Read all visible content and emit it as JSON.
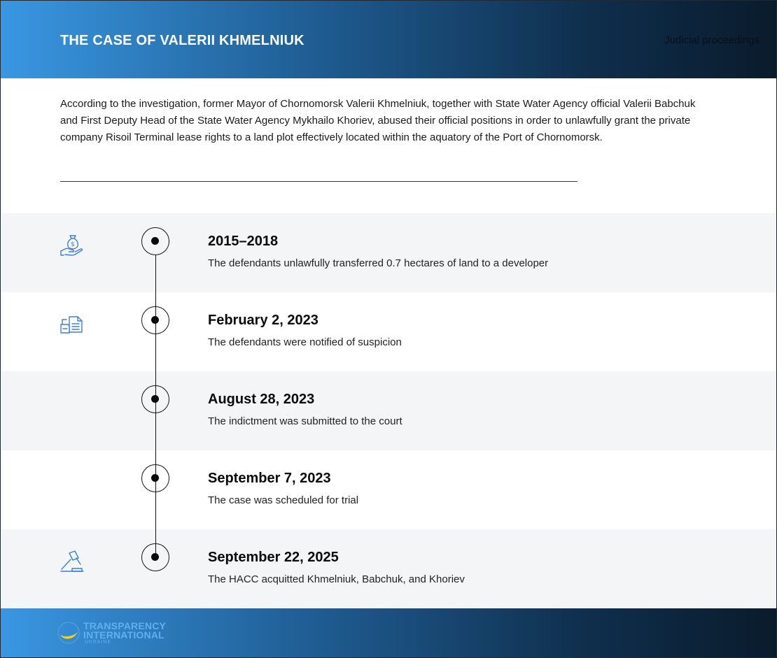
{
  "header": {
    "title": "THE CASE OF VALERII KHMELNIUK",
    "category": "Judicial proceedings"
  },
  "intro": "According to the investigation, former Mayor of Chornomorsk Valerii Khmelniuk, together with State Water Agency official Valerii Babchuk and First Deputy Head of the State Water Agency Mykhailo Khoriev, abused their official positions in order to unlawfully grant the private company Risoil Terminal lease rights to a land plot effectively located within the aquatory of the Port of Chornomorsk.",
  "timeline": [
    {
      "date": "2015–2018",
      "description": "The defendants unlawfully transferred 0.7 hectares of land to a developer",
      "icon": "money-bag-hand-icon"
    },
    {
      "date": "February 2, 2023",
      "description": "The defendants were notified of suspicion",
      "icon": "documents-icon"
    },
    {
      "date": "August 28, 2023",
      "description": "The indictment was submitted to the court",
      "icon": ""
    },
    {
      "date": "September 7, 2023",
      "description": "The case was scheduled for trial",
      "icon": ""
    },
    {
      "date": "September 22, 2025",
      "description": "The HACC acquitted Khmelniuk, Babchuk, and Khoriev",
      "icon": "gavel-icon"
    }
  ],
  "footer": {
    "logo_line1": "TRANSPARENCY",
    "logo_line2": "INTERNATIONAL",
    "logo_line3": "UKRAINE"
  },
  "colors": {
    "accent_blue": "#3a97e2",
    "dark_navy": "#0a1b2c",
    "icon_blue": "#3b7fd6",
    "row_shade": "#f4f5f7"
  }
}
